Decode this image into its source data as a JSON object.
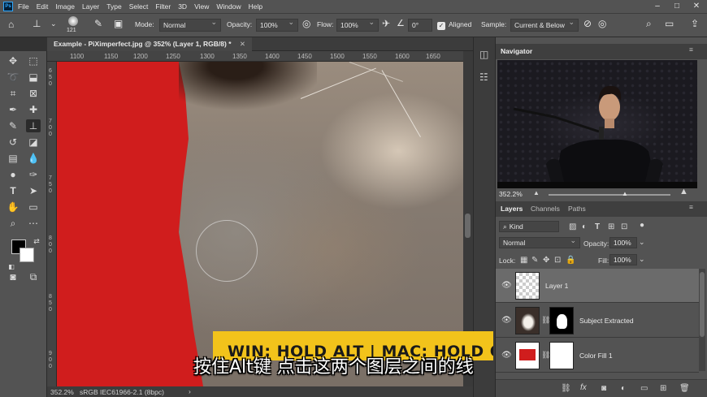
{
  "menubar": {
    "app_icon": "Ps",
    "items": [
      "File",
      "Edit",
      "Image",
      "Layer",
      "Type",
      "Select",
      "Filter",
      "3D",
      "View",
      "Window",
      "Help"
    ]
  },
  "options": {
    "brush_size": "121",
    "mode_label": "Mode:",
    "mode_value": "Normal",
    "opacity_label": "Opacity:",
    "opacity_value": "100%",
    "flow_label": "Flow:",
    "flow_value": "100%",
    "angle_value": "0°",
    "aligned_label": "Aligned",
    "sample_label": "Sample:",
    "sample_value": "Current & Below"
  },
  "document": {
    "tab_title": "Example - PiXimperfect.jpg @ 352% (Layer 1, RGB/8) *",
    "ruler_ticks": [
      "1100",
      "1150",
      "1200",
      "1250",
      "1300",
      "1350",
      "1400",
      "1450",
      "1500",
      "1550",
      "1600",
      "1650"
    ],
    "vruler_ticks": [
      "6",
      "5",
      "0",
      "7",
      "0",
      "0",
      "7",
      "5",
      "0",
      "8",
      "0",
      "0",
      "8",
      "5",
      "0",
      "9",
      "0",
      "0"
    ],
    "status_zoom": "352.2%",
    "status_profile": "sRGB IEC61966-2.1 (8bpc)"
  },
  "navigator": {
    "title": "Navigator",
    "zoom": "352.2%"
  },
  "layers_panel": {
    "tabs": [
      "Layers",
      "Channels",
      "Paths"
    ],
    "filter_kind": "Kind",
    "blend_mode": "Normal",
    "opacity_label": "Opacity:",
    "opacity_value": "100%",
    "lock_label": "Lock:",
    "fill_label": "Fill:",
    "fill_value": "100%",
    "layers": [
      {
        "name": "Layer 1"
      },
      {
        "name": "Subject Extracted"
      },
      {
        "name": "Color Fill 1"
      }
    ],
    "fx_label": "fx"
  },
  "overlay": {
    "banner": "WIN: HOLD ALT | MAC: HOLD OPTION",
    "subtitle": "按住Alt键 点击这两个图层之间的线"
  },
  "colors": {
    "red_fill": "#d01d1d",
    "banner_yellow": "#f2c31b"
  }
}
